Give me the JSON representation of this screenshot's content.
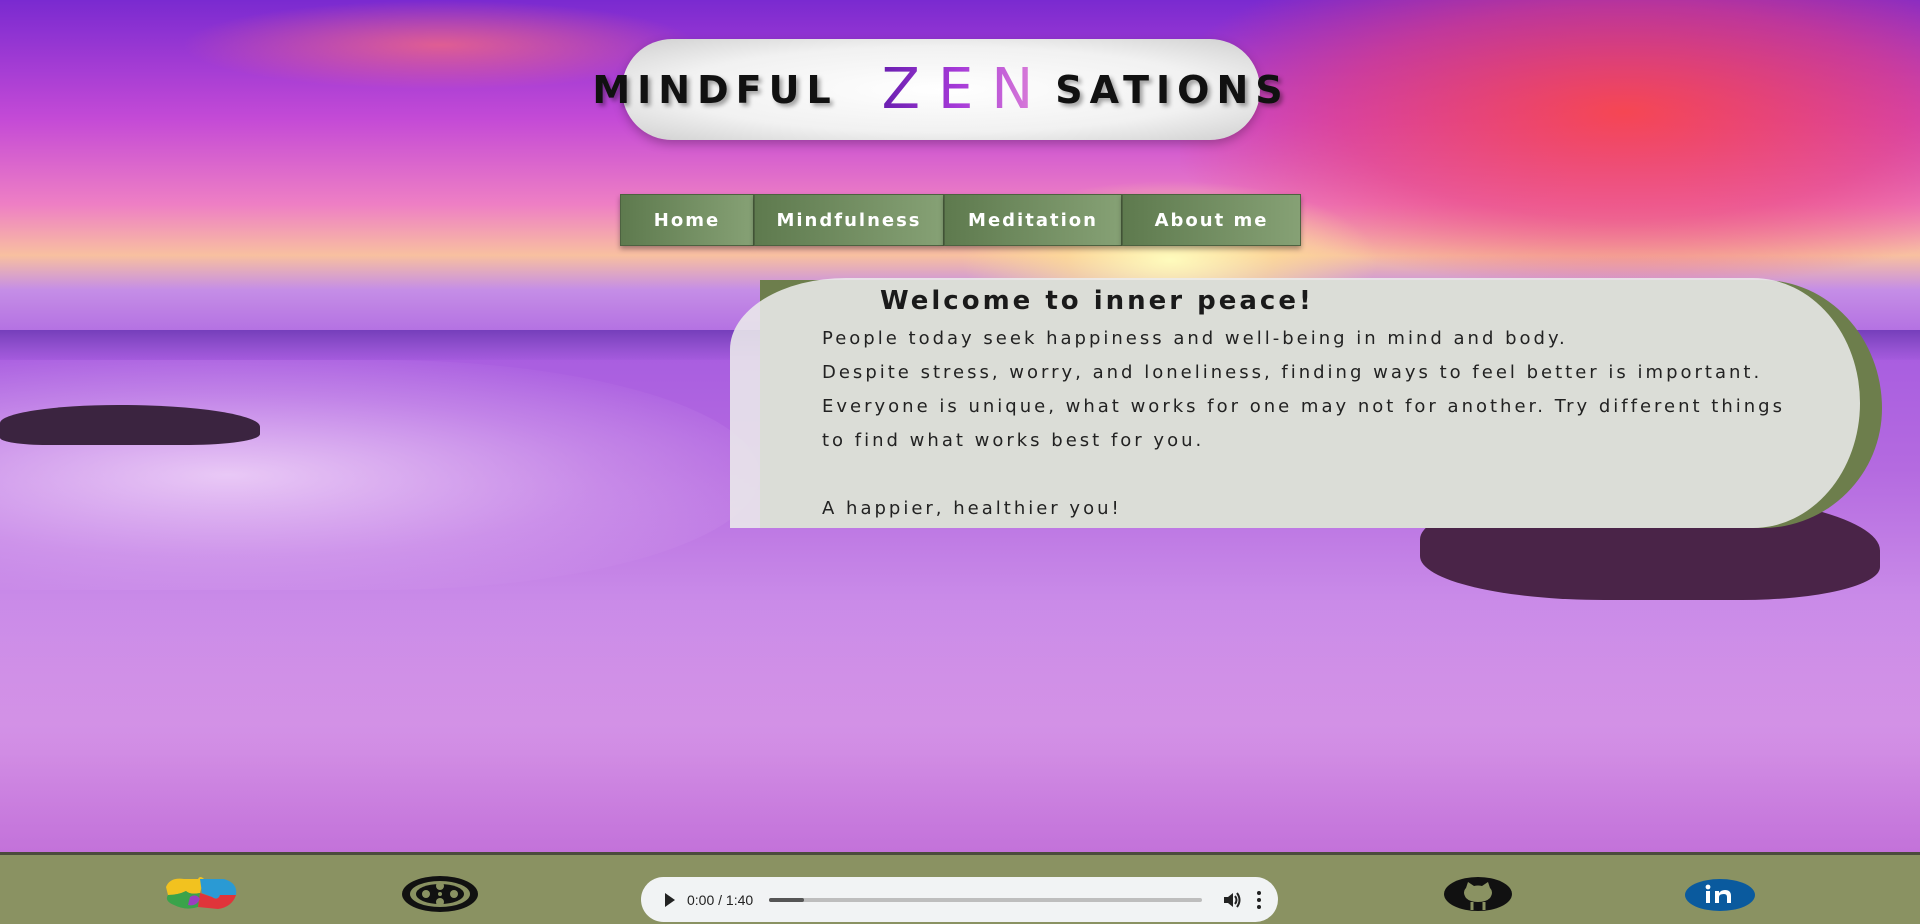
{
  "header": {
    "title_left": "MINDFUL",
    "title_accent": "ZEN",
    "title_right": "SATIONS"
  },
  "nav": {
    "items": [
      {
        "label": "Home"
      },
      {
        "label": "Mindfulness"
      },
      {
        "label": "Meditation"
      },
      {
        "label": "About me"
      }
    ]
  },
  "welcome": {
    "heading": "Welcome to inner peace!",
    "paragraph_1": "People today seek happiness and well-being in mind and body.",
    "paragraph_2": "Despite stress, worry, and loneliness, finding ways to feel better is important. Everyone is unique, what works for one may not for another. Try different things to find what works best for you.",
    "paragraph_3": "A happier, healthier you!"
  },
  "audio_player": {
    "time": "0:00 / 1:40",
    "progress": 0.08
  },
  "footer": {
    "icons": [
      "puzzle-icon",
      "film-reel-icon",
      "github-icon",
      "linkedin-icon"
    ]
  },
  "colors": {
    "nav_green": "#6f8a5e",
    "footer_green": "#8a9262",
    "accent_purple": "#8b2ac4"
  }
}
